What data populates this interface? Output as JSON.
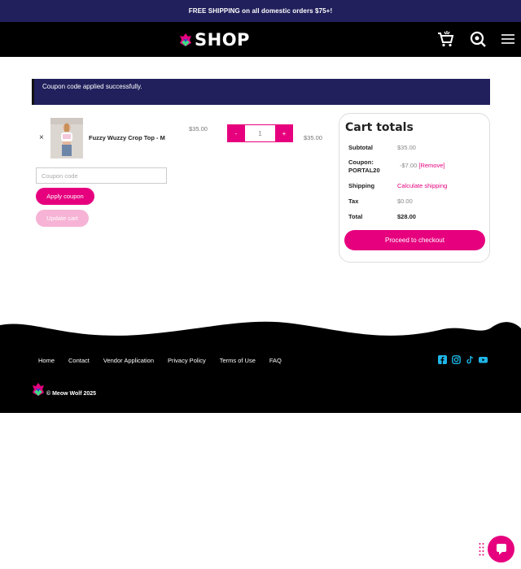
{
  "promo": {
    "text": "FREE SHIPPING on all domestic orders $75+!"
  },
  "header": {
    "logo_text": "SHOP",
    "icons": [
      "cart-icon",
      "search-icon",
      "menu-icon"
    ]
  },
  "notice": {
    "text": "Coupon code applied successfully."
  },
  "cart": {
    "item": {
      "remove_label": "×",
      "name": "Fuzzy Wuzzy Crop Top - M",
      "price": "$35.00",
      "qty_minus": "-",
      "quantity": "1",
      "qty_plus": "+",
      "subtotal": "$35.00"
    },
    "coupon_placeholder": "Coupon code",
    "apply_label": "Apply coupon",
    "update_label": "Update cart"
  },
  "totals": {
    "title": "Cart totals",
    "subtotal_label": "Subtotal",
    "subtotal_value": "$35.00",
    "coupon_label": "Coupon: PORTAL20",
    "coupon_value": "-$7.00",
    "coupon_remove": "[Remove]",
    "shipping_label": "Shipping",
    "shipping_link": "Calculate shipping",
    "tax_label": "Tax",
    "tax_value": "$0.00",
    "total_label": "Total",
    "total_value": "$28.00",
    "checkout_label": "Proceed to checkout"
  },
  "footer": {
    "nav": [
      "Home",
      "Contact",
      "Vendor Application",
      "Privacy Policy",
      "Terms of Use",
      "FAQ"
    ],
    "social_icons": [
      "facebook-icon",
      "instagram-icon",
      "tiktok-icon",
      "youtube-icon"
    ],
    "copyright": "© Meow Wolf 2025"
  },
  "colors": {
    "brand_pink": "#e6007e",
    "navy": "#21205c",
    "social_blue": "#1fb6e8"
  }
}
